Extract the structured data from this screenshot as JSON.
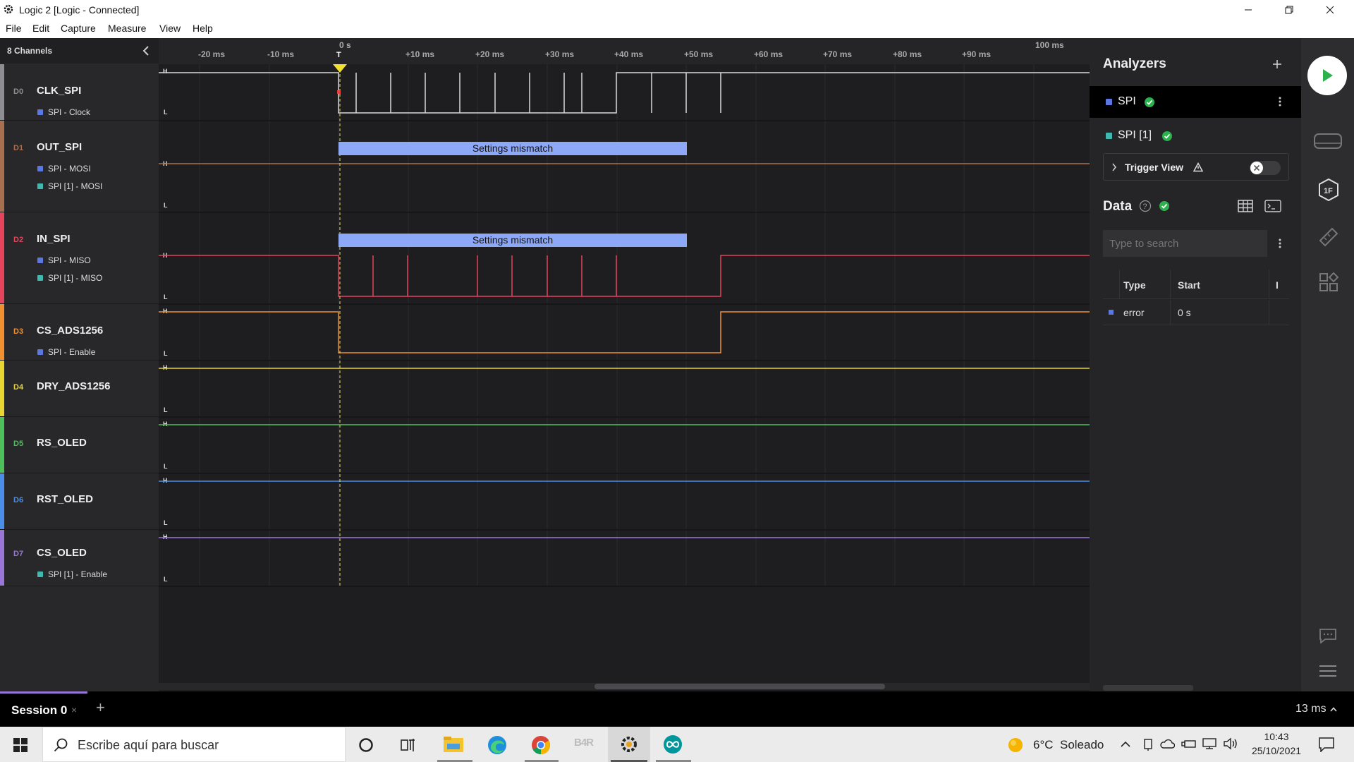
{
  "window": {
    "title": "Logic 2 [Logic - Connected]"
  },
  "menu": [
    "File",
    "Edit",
    "Capture",
    "Measure",
    "View",
    "Help"
  ],
  "sidebar": {
    "header": "8 Channels",
    "channels": [
      {
        "id": "D0",
        "name": "CLK_SPI",
        "color": "#8e8e92",
        "subs": [
          {
            "label": "SPI - Clock",
            "color": "#5c78e0"
          }
        ]
      },
      {
        "id": "D1",
        "name": "OUT_SPI",
        "color": "#a8704e",
        "subs": [
          {
            "label": "SPI - MOSI",
            "color": "#5c78e0"
          },
          {
            "label": "SPI [1] - MOSI",
            "color": "#3fb8b0"
          }
        ]
      },
      {
        "id": "D2",
        "name": "IN_SPI",
        "color": "#e4445c",
        "subs": [
          {
            "label": "SPI - MISO",
            "color": "#5c78e0"
          },
          {
            "label": "SPI [1] - MISO",
            "color": "#3fb8b0"
          }
        ]
      },
      {
        "id": "D3",
        "name": "CS_ADS1256",
        "color": "#f09030",
        "subs": [
          {
            "label": "SPI - Enable",
            "color": "#5c78e0"
          }
        ]
      },
      {
        "id": "D4",
        "name": "DRY_ADS1256",
        "color": "#e8d632",
        "subs": []
      },
      {
        "id": "D5",
        "name": "RS_OLED",
        "color": "#4ec05a",
        "subs": []
      },
      {
        "id": "D6",
        "name": "RST_OLED",
        "color": "#4a8ee8",
        "subs": []
      },
      {
        "id": "D7",
        "name": "CS_OLED",
        "color": "#9a76d8",
        "subs": [
          {
            "label": "SPI [1] - Enable",
            "color": "#3fb8b0"
          }
        ]
      }
    ]
  },
  "timeline": {
    "ticks": [
      "-20 ms",
      "-10 ms",
      "0 s",
      "+10 ms",
      "+20 ms",
      "+30 ms",
      "+40 ms",
      "+50 ms",
      "+60 ms",
      "+70 ms",
      "+80 ms",
      "+90 ms",
      "100 ms"
    ],
    "trigger_label": "T",
    "level_high": "H",
    "level_low": "L",
    "annotations": [
      "Settings mismatch",
      "Settings mismatch"
    ]
  },
  "analyzers": {
    "title": "Analyzers",
    "items": [
      {
        "label": "SPI",
        "status": "ok"
      },
      {
        "label": "SPI [1]",
        "status": "ok"
      }
    ],
    "trigger_view": {
      "label": "Trigger View",
      "enabled": false
    }
  },
  "data_panel": {
    "title": "Data",
    "search_placeholder": "Type to search",
    "columns": [
      "Type",
      "Start",
      "I"
    ],
    "rows": [
      {
        "type": "error",
        "start": "0 s"
      }
    ]
  },
  "session": {
    "tab": "Session 0",
    "close": "×",
    "add": "+",
    "zoom": "13 ms"
  },
  "taskbar": {
    "search_placeholder": "Escribe aquí para buscar",
    "weather": "6°C  Soleado",
    "time": "10:43",
    "date": "25/10/2021",
    "b4r_label": "B4R"
  }
}
